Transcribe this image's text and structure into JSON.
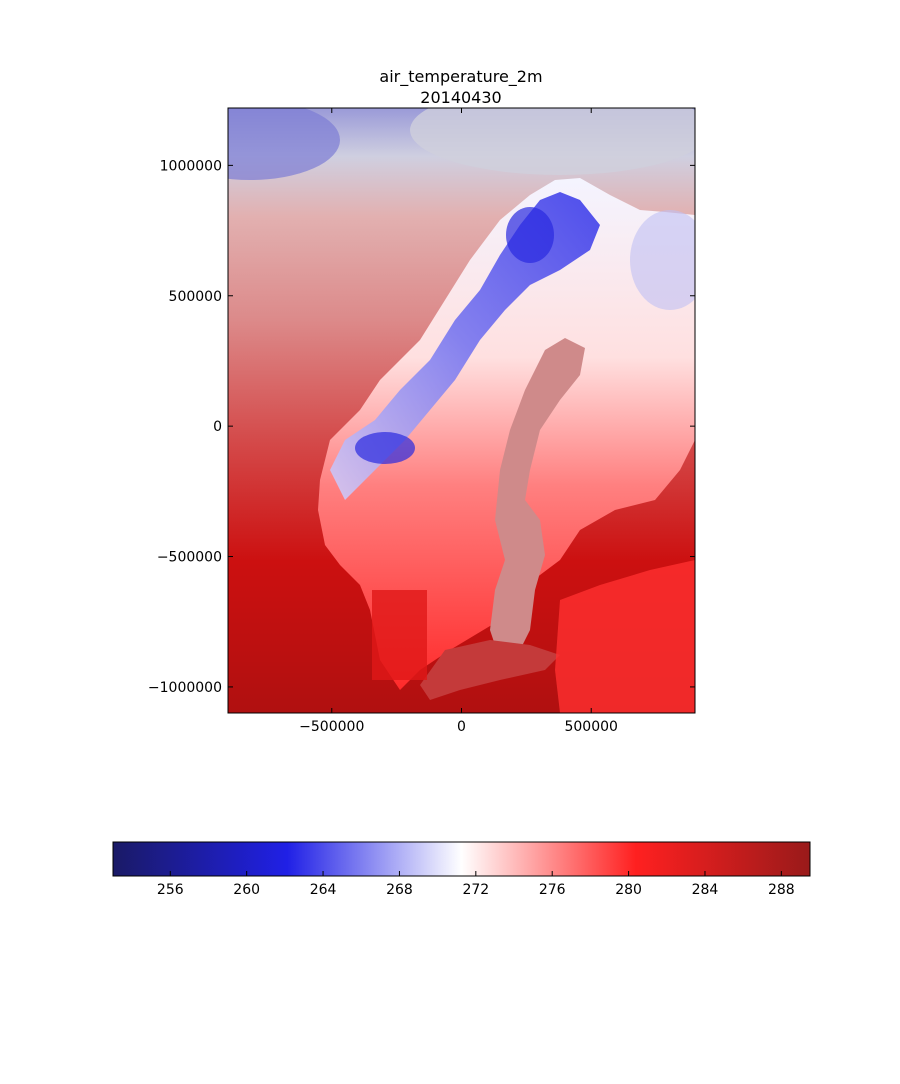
{
  "chart_data": {
    "type": "heatmap",
    "title": "air_temperature_2m",
    "subtitle": "20140430",
    "xlabel": "",
    "ylabel": "",
    "xlim": [
      -900000,
      900000
    ],
    "ylim": [
      -1100000,
      1220000
    ],
    "x_ticks": [
      {
        "value": -500000,
        "label": "−500000"
      },
      {
        "value": 0,
        "label": "0"
      },
      {
        "value": 500000,
        "label": "500000"
      }
    ],
    "y_ticks": [
      {
        "value": 1000000,
        "label": "1000000"
      },
      {
        "value": 500000,
        "label": "500000"
      },
      {
        "value": 0,
        "label": "0"
      },
      {
        "value": -500000,
        "label": "−500000"
      },
      {
        "value": -1000000,
        "label": "−1000000"
      }
    ],
    "colorbar": {
      "orientation": "horizontal",
      "range": [
        253,
        289.5
      ],
      "ticks": [
        "256",
        "260",
        "264",
        "268",
        "272",
        "276",
        "280",
        "284",
        "288"
      ],
      "colors": [
        "#1a1a66",
        "#2020e6",
        "#ffffff",
        "#ff2020",
        "#991a1a"
      ]
    },
    "grid": false
  }
}
